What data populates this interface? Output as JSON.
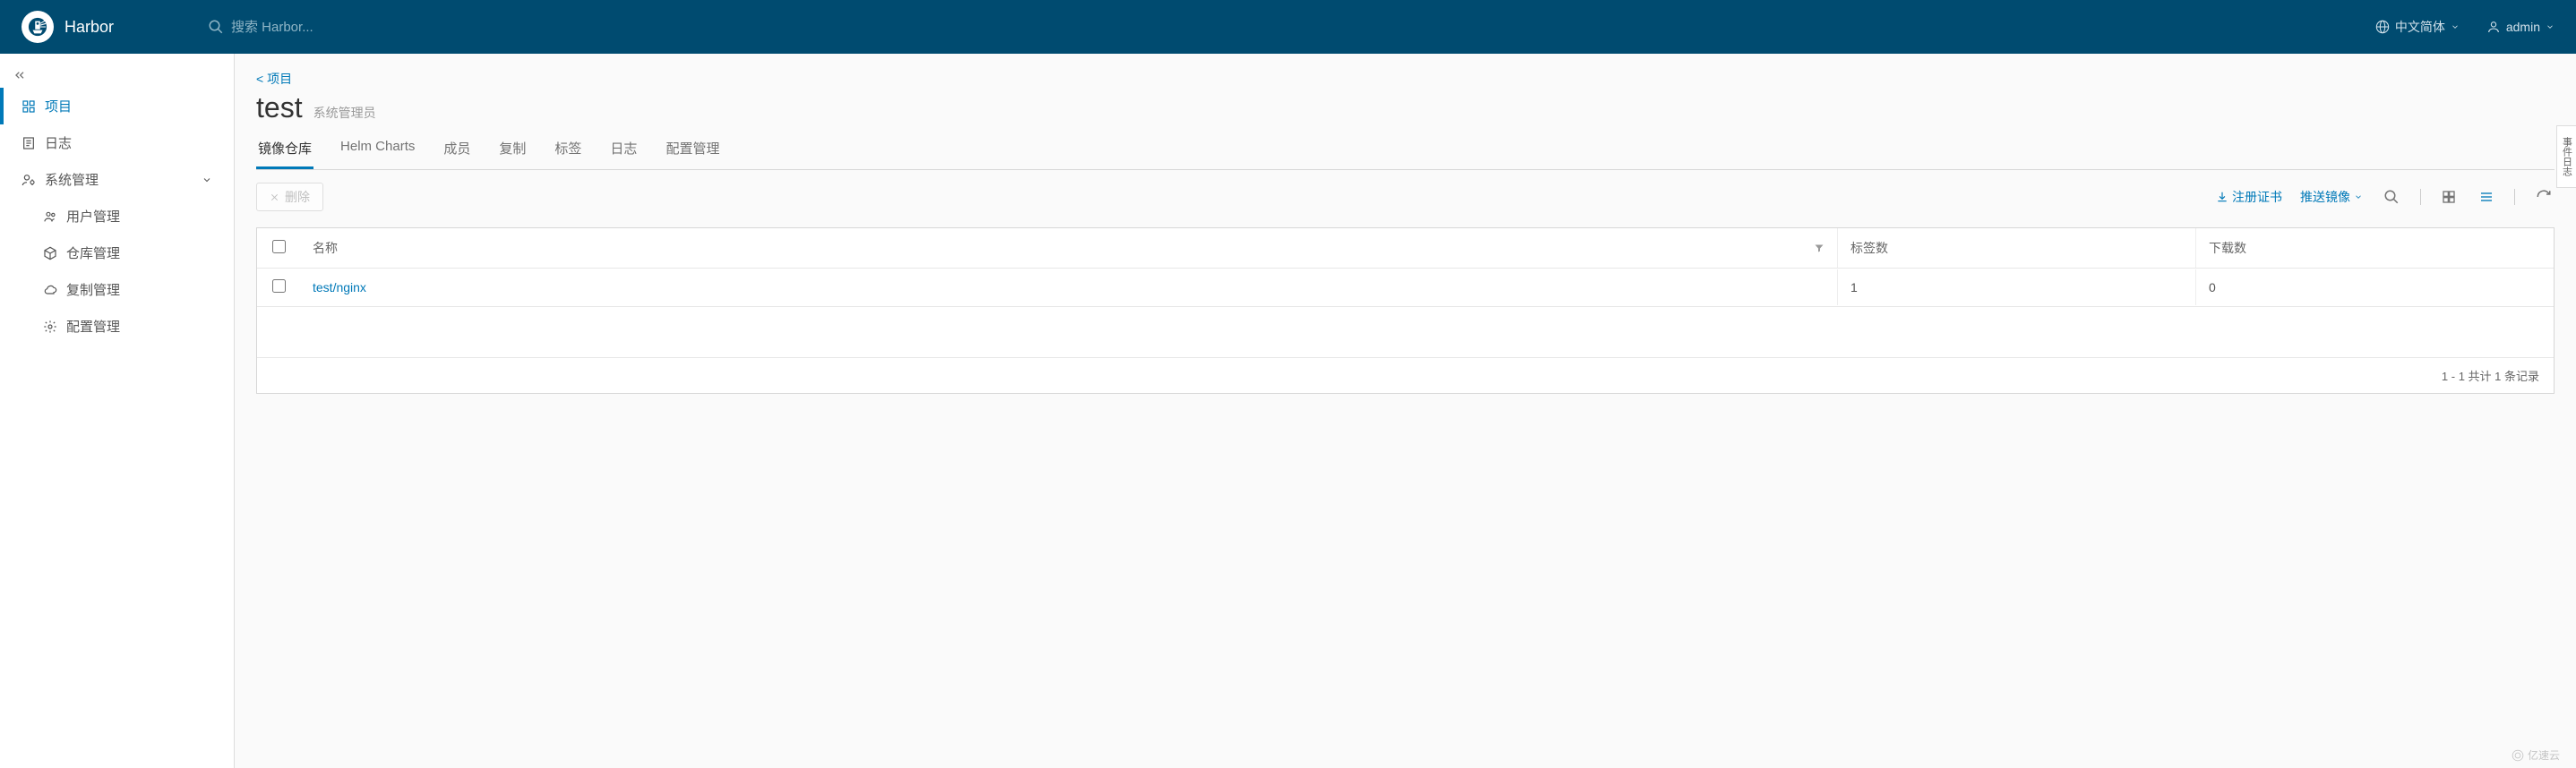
{
  "header": {
    "product": "Harbor",
    "search_placeholder": "搜索 Harbor...",
    "language": "中文简体",
    "user": "admin"
  },
  "sidebar": {
    "items": {
      "projects": "项目",
      "logs": "日志",
      "admin": "系统管理",
      "users": "用户管理",
      "registries": "仓库管理",
      "replications": "复制管理",
      "config": "配置管理"
    }
  },
  "breadcrumb": "< 项目",
  "project": {
    "name": "test",
    "role": "系统管理员"
  },
  "tabs": {
    "repos": "镜像仓库",
    "helm": "Helm Charts",
    "members": "成员",
    "replication": "复制",
    "labels": "标签",
    "logs": "日志",
    "config": "配置管理"
  },
  "toolbar": {
    "delete": "删除",
    "cert": "注册证书",
    "push": "推送镜像"
  },
  "grid": {
    "columns": {
      "name": "名称",
      "tags": "标签数",
      "pulls": "下载数"
    },
    "rows": [
      {
        "name": "test/nginx",
        "tags": "1",
        "pulls": "0"
      }
    ],
    "footer": "1 - 1 共计 1 条记录"
  },
  "side_handle": "事件日志",
  "watermark": "亿速云"
}
